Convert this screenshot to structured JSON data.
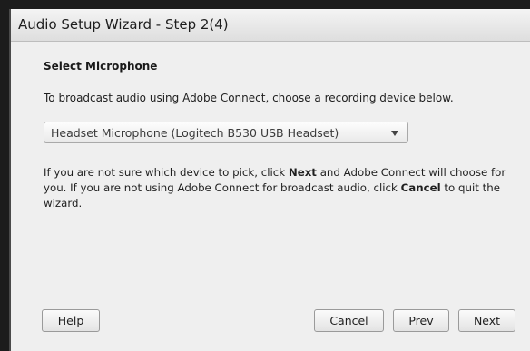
{
  "window": {
    "title": "Audio Setup Wizard - Step 2(4)"
  },
  "content": {
    "heading": "Select Microphone",
    "instruction": "To broadcast audio using Adobe Connect, choose a recording device below.",
    "device_select": {
      "selected": "Headset Microphone (Logitech B530 USB Headset)",
      "icon": "chevron-down-icon"
    },
    "info": {
      "part1": "If you are not sure which device to pick, click ",
      "next_word": "Next",
      "part2": " and Adobe Connect will choose for you. If you are not using Adobe Connect for broadcast audio, click ",
      "cancel_word": "Cancel",
      "part3": " to quit the wizard."
    }
  },
  "buttons": {
    "help": "Help",
    "cancel": "Cancel",
    "prev": "Prev",
    "next": "Next"
  }
}
